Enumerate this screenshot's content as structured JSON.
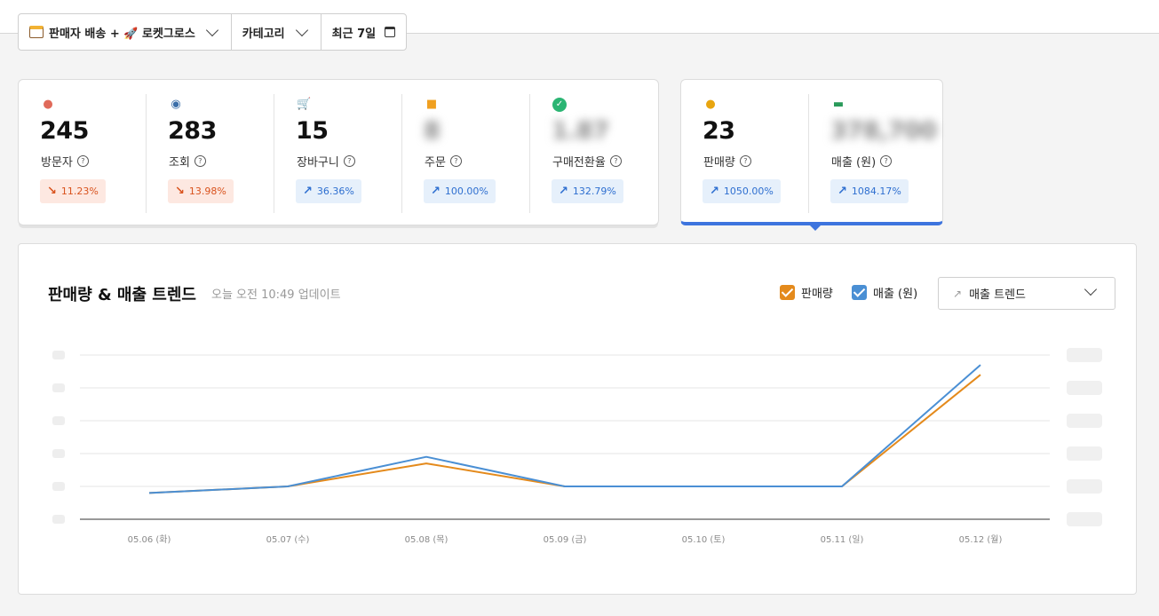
{
  "filters": {
    "seller": "판매자 배송 + 🚀 로켓그로스",
    "category": "카테고리",
    "period": "최근 7일"
  },
  "metrics": [
    {
      "icon": "person-icon",
      "value": "245",
      "label": "방문자",
      "change": "11.23%",
      "dir": "down",
      "blur": false
    },
    {
      "icon": "eye-icon",
      "value": "283",
      "label": "조회",
      "change": "13.98%",
      "dir": "down",
      "blur": false
    },
    {
      "icon": "cart-icon",
      "value": "15",
      "label": "장바구니",
      "change": "36.36%",
      "dir": "up",
      "blur": false
    },
    {
      "icon": "box-icon",
      "value": "",
      "label": "주문",
      "change": "100.00%",
      "dir": "up",
      "blur": true
    },
    {
      "icon": "check-icon",
      "value": "",
      "label": "구매전환율",
      "change": "132.79%",
      "dir": "up",
      "blur": true
    }
  ],
  "sales_metrics": [
    {
      "icon": "coins-icon",
      "value": "23",
      "label": "판매량",
      "change": "1050.00%",
      "dir": "up",
      "blur": false
    },
    {
      "icon": "cash-icon",
      "value": "",
      "label": "매출 (원)",
      "change": "1084.17%",
      "dir": "up",
      "blur": true
    }
  ],
  "chart_section": {
    "title": "판매량 & 매출 트렌드",
    "updated": "오늘 오전 10:49 업데이트",
    "legend_sales": "판매량",
    "legend_revenue": "매출 (원)",
    "select_label": "매출 트렌드"
  },
  "colors": {
    "sales": "#e48a1c",
    "revenue": "#4a8fd4",
    "accent": "#3d74de"
  },
  "chart_data": {
    "type": "line",
    "categories": [
      "05.06 (화)",
      "05.07 (수)",
      "05.08 (목)",
      "05.09 (금)",
      "05.10 (토)",
      "05.11 (일)",
      "05.12 (월)"
    ],
    "series": [
      {
        "name": "판매량",
        "values": [
          0.8,
          1.0,
          1.7,
          1.0,
          1.0,
          1.0,
          4.4
        ]
      },
      {
        "name": "매출 (원)",
        "values": [
          0.8,
          1.0,
          1.9,
          1.0,
          1.0,
          1.0,
          4.7
        ]
      }
    ],
    "ylim": [
      0,
      5
    ],
    "grid": true
  }
}
